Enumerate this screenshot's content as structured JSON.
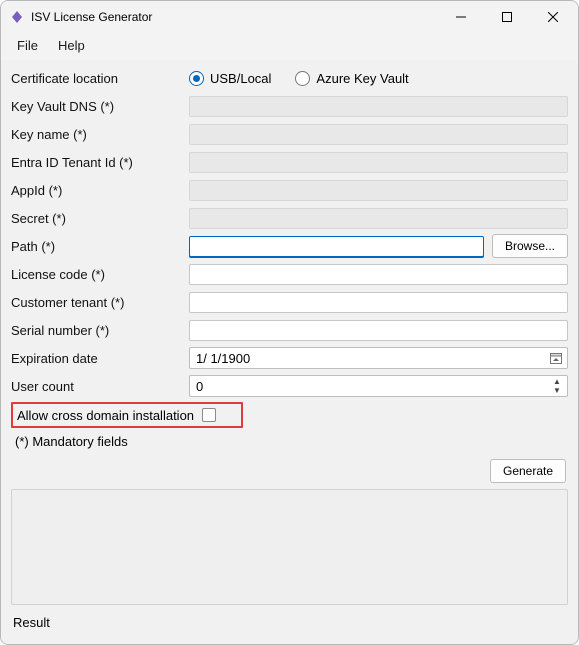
{
  "window": {
    "title": "ISV License Generator"
  },
  "menu": {
    "file": "File",
    "help": "Help"
  },
  "labels": {
    "cert_location": "Certificate location",
    "key_vault_dns": "Key Vault DNS (*)",
    "key_name": "Key name (*)",
    "tenant_id": "Entra ID Tenant Id (*)",
    "app_id": "AppId (*)",
    "secret": "Secret (*)",
    "path": "Path (*)",
    "license_code": "License code (*)",
    "customer_tenant": "Customer tenant (*)",
    "serial_number": "Serial number (*)",
    "expiration_date": "Expiration date",
    "user_count": "User count",
    "allow_cross": "Allow cross domain installation",
    "mandatory": "(*) Mandatory fields",
    "result": "Result"
  },
  "radios": {
    "usb_local": "USB/Local",
    "azure": "Azure Key Vault",
    "selected": "usb_local"
  },
  "values": {
    "path": "",
    "license_code": "",
    "customer_tenant": "",
    "serial_number": "",
    "expiration_date": "1/  1/1900",
    "user_count": "0"
  },
  "buttons": {
    "browse": "Browse...",
    "generate": "Generate"
  }
}
